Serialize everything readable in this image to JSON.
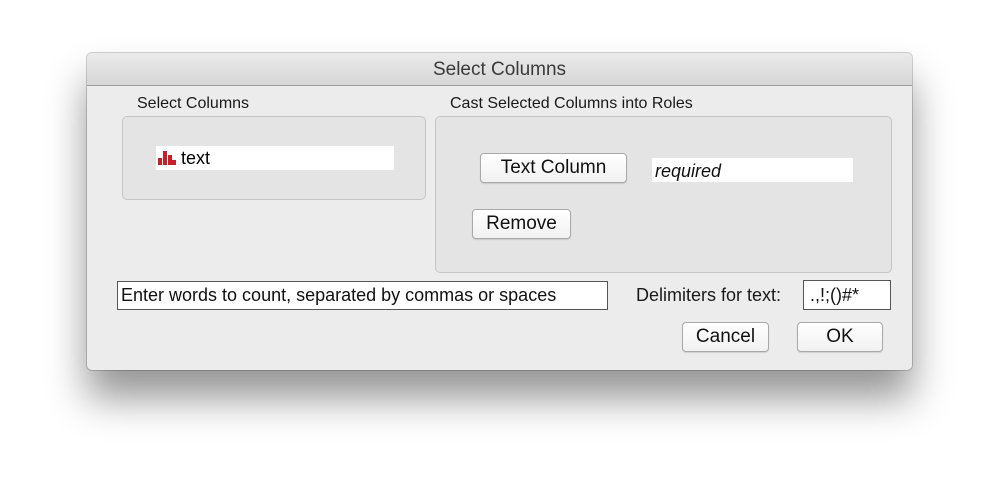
{
  "dialog": {
    "title": "Select Columns"
  },
  "select_columns": {
    "label": "Select Columns",
    "columns": [
      {
        "name": "text",
        "icon": "bar-chart-icon"
      }
    ]
  },
  "cast_roles": {
    "label": "Cast Selected Columns into Roles",
    "text_column_button": "Text Column",
    "text_column_value": "required",
    "remove_button": "Remove"
  },
  "words_field": {
    "value": "Enter words to count, separated by commas or spaces"
  },
  "delimiters": {
    "label": "Delimiters for text:",
    "value": ".,!;()#*"
  },
  "footer": {
    "cancel_label": "Cancel",
    "ok_label": "OK"
  },
  "colors": {
    "icon_accent": "#c8202a",
    "panel_bg": "#e4e4e4",
    "window_bg": "#ececec"
  }
}
